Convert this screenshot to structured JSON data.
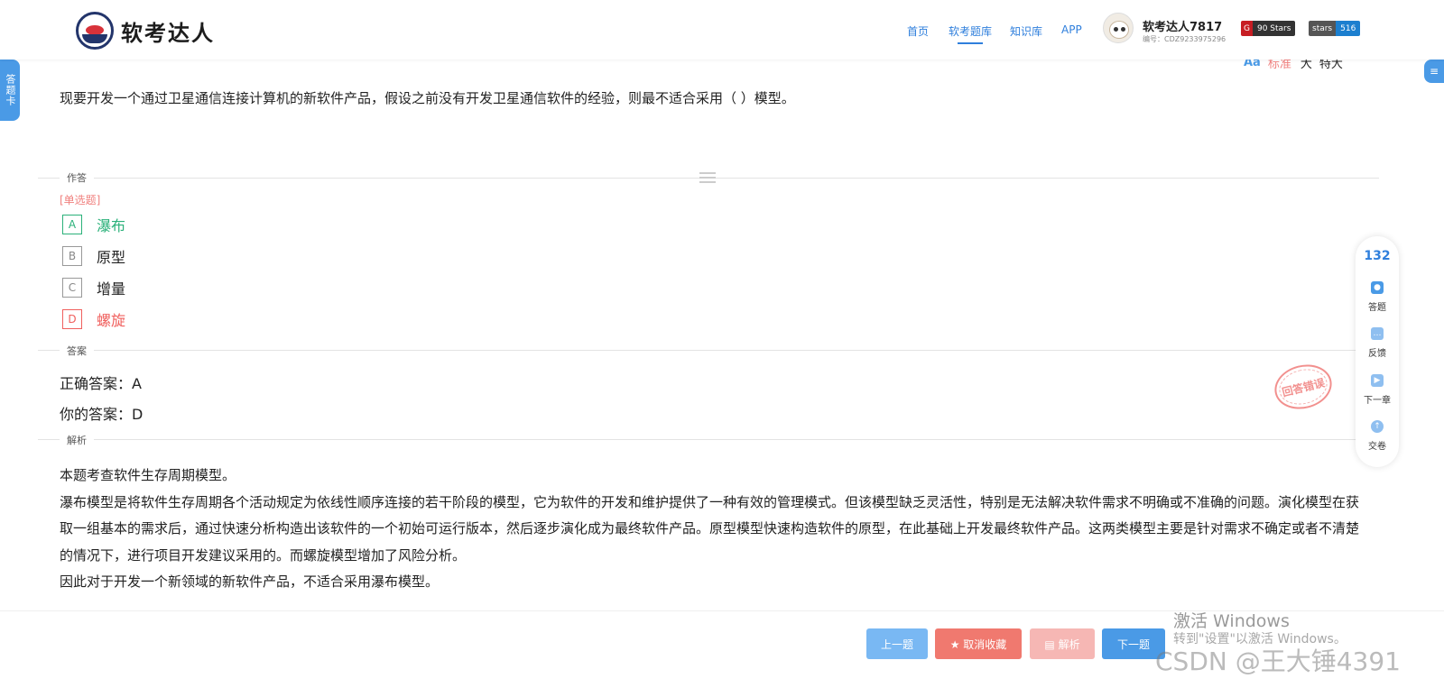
{
  "header": {
    "logo_text": "软考达人",
    "nav": [
      "首页",
      "软考题库",
      "知识库",
      "APP"
    ],
    "user_name": "软考达人7817",
    "user_id": "编号：CDZ9233975296",
    "badge1": {
      "label": "G",
      "value": "90 Stars"
    },
    "badge2": {
      "label": "stars",
      "value": "516"
    }
  },
  "side": {
    "answer_card": "答题卡",
    "right_icon": "≡"
  },
  "font_switch": {
    "aa": "Aa",
    "standard": "标准",
    "large": "大",
    "xlarge": "特大"
  },
  "question": {
    "text": "现要开发一个通过卫星通信连接计算机的新软件产品，假设之前没有开发卫星通信软件的经验，则最不适合采用（ ）模型。",
    "section_answer": "作答",
    "type": "[单选题]",
    "options": [
      {
        "letter": "A",
        "text": "瀑布"
      },
      {
        "letter": "B",
        "text": "原型"
      },
      {
        "letter": "C",
        "text": "增量"
      },
      {
        "letter": "D",
        "text": "螺旋"
      }
    ]
  },
  "answer": {
    "section": "答案",
    "correct": "正确答案：A",
    "yours": "你的答案：D",
    "stamp": "回答错误"
  },
  "explanation": {
    "section": "解析",
    "paragraphs": [
      "本题考查软件生存周期模型。",
      "瀑布模型是将软件生存周期各个活动规定为依线性顺序连接的若干阶段的模型，它为软件的开发和维护提供了一种有效的管理模式。但该模型缺乏灵活性，特别是无法解决软件需求不明确或不准确的问题。演化模型在获取一组基本的需求后，通过快速分析构造出该软件的一个初始可运行版本，然后逐步演化成为最终软件产品。原型模型快速构造软件的原型，在此基础上开发最终软件产品。这两类模型主要是针对需求不确定或者不清楚的情况下，进行项目开发建议采用的。而螺旋模型增加了风险分析。",
      "因此对于开发一个新领域的新软件产品，不适合采用瀑布模型。"
    ]
  },
  "float_panel": {
    "count": "132",
    "items": [
      "答题",
      "反馈",
      "下一章",
      "交卷"
    ]
  },
  "buttons": {
    "prev": "上一题",
    "fav": "★ 取消收藏",
    "explain": "▤ 解析",
    "next": "下一题"
  },
  "watermark": {
    "line1": "激活 Windows",
    "line2": "转到\"设置\"以激活 Windows。",
    "line3": "CSDN @王大锤4391"
  },
  "colors": {
    "accent": "#4a9ae6",
    "correct": "#2bb17a",
    "wrong": "#f0605e"
  }
}
